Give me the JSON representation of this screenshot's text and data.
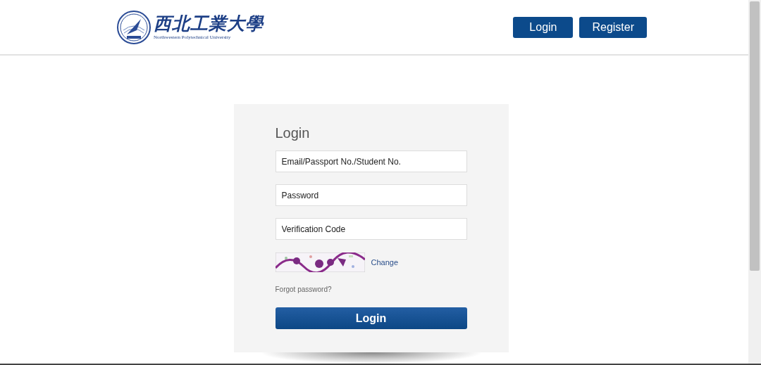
{
  "header": {
    "logo": {
      "name_zh": "西北工業大學",
      "name_en": "Northwestern Polytechnical University"
    },
    "buttons": [
      {
        "label": "Login"
      },
      {
        "label": "Register"
      }
    ]
  },
  "login_form": {
    "title": "Login",
    "fields": [
      {
        "placeholder": "Email/Passport No./Student No."
      },
      {
        "placeholder": "Password"
      },
      {
        "placeholder": "Verification Code"
      }
    ],
    "captcha": {
      "kind": "picture",
      "change_link": "Change"
    },
    "forgot_link": "Forgot password?",
    "submit": "Login"
  }
}
